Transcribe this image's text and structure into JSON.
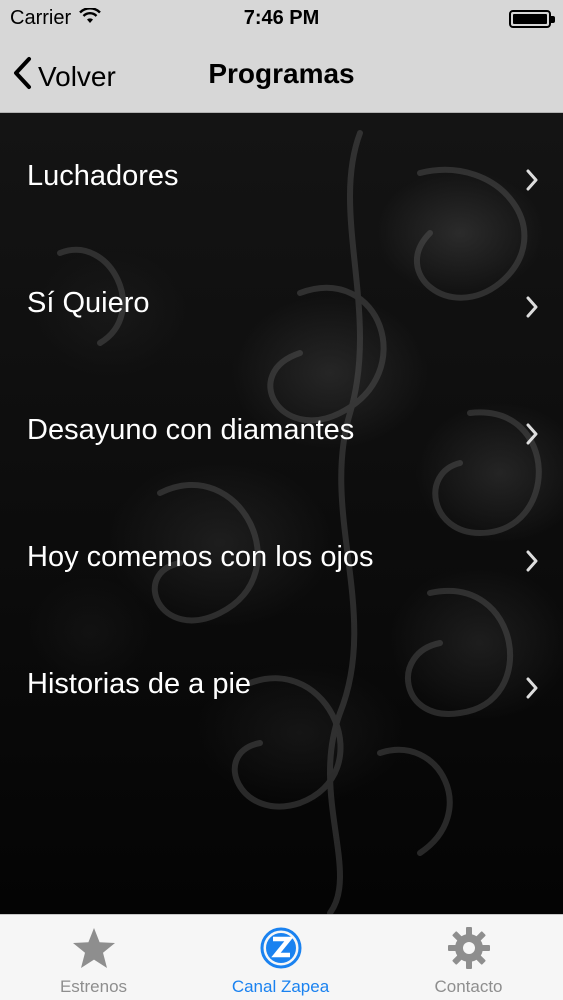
{
  "status_bar": {
    "carrier": "Carrier",
    "time": "7:46 PM"
  },
  "nav": {
    "back_label": "Volver",
    "title": "Programas"
  },
  "programs": [
    {
      "label": "Luchadores"
    },
    {
      "label": "Sí Quiero"
    },
    {
      "label": "Desayuno con diamantes"
    },
    {
      "label": "Hoy comemos con los ojos"
    },
    {
      "label": "Historias de a pie"
    }
  ],
  "tabs": [
    {
      "label": "Estrenos",
      "icon": "star-icon",
      "active": false
    },
    {
      "label": "Canal Zapea",
      "icon": "zapea-logo-icon",
      "active": true
    },
    {
      "label": "Contacto",
      "icon": "gear-icon",
      "active": false
    }
  ],
  "colors": {
    "accent": "#1a82f0",
    "inactive_tab": "#8e8e8e",
    "bar_background": "#d7d7d7"
  }
}
